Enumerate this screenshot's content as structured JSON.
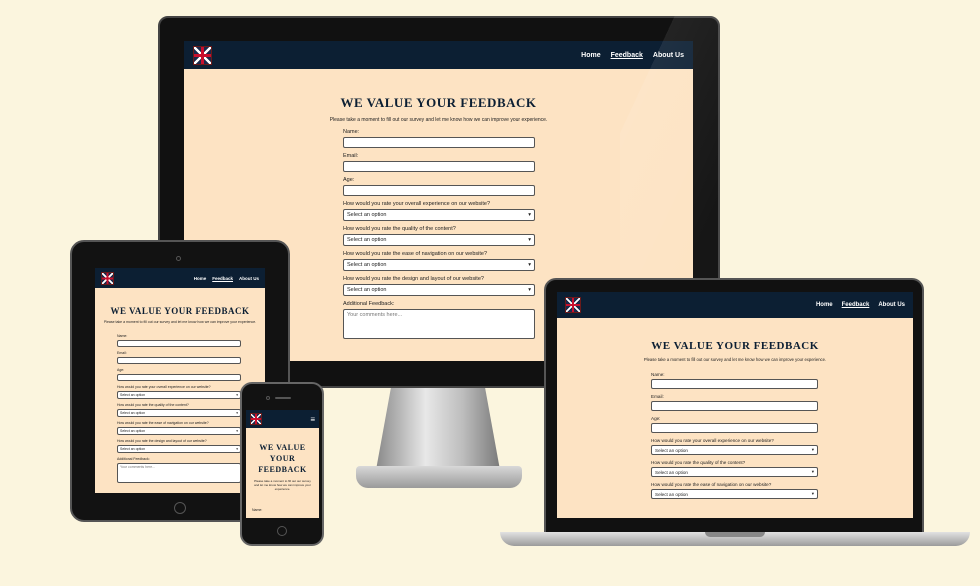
{
  "site": {
    "nav": {
      "links": [
        "Home",
        "Feedback",
        "About Us"
      ],
      "active": "Feedback"
    },
    "title": "WE VALUE YOUR FEEDBACK",
    "title_mobile_lines": [
      "WE VALUE",
      "YOUR",
      "FEEDBACK"
    ],
    "intro": "Please take a moment to fill out our survey and let me know how we can improve your experience.",
    "intro_mobile": "Please take a moment to fill out our survey and let me know how we can improve your experience.",
    "fields": {
      "name_label": "Name:",
      "email_label": "Email:",
      "age_label": "Age:",
      "q1_label": "How would you rate your overall experience on our website?",
      "q2_label": "How would you rate the quality of the content?",
      "q3_label": "How would you rate the ease of navigation on our website?",
      "q4_label": "How would you rate the design and layout of our website?",
      "select_placeholder": "Select an option",
      "feedback_label": "Additional Feedback:",
      "feedback_placeholder": "Your comments here..."
    }
  },
  "icons": {
    "logo": "union-jack-icon",
    "menu": "hamburger-menu-icon",
    "select": "chevron-down-icon"
  },
  "colors": {
    "navy": "#0c1f33",
    "peach": "#fde3c3",
    "background": "#fbf5de"
  }
}
